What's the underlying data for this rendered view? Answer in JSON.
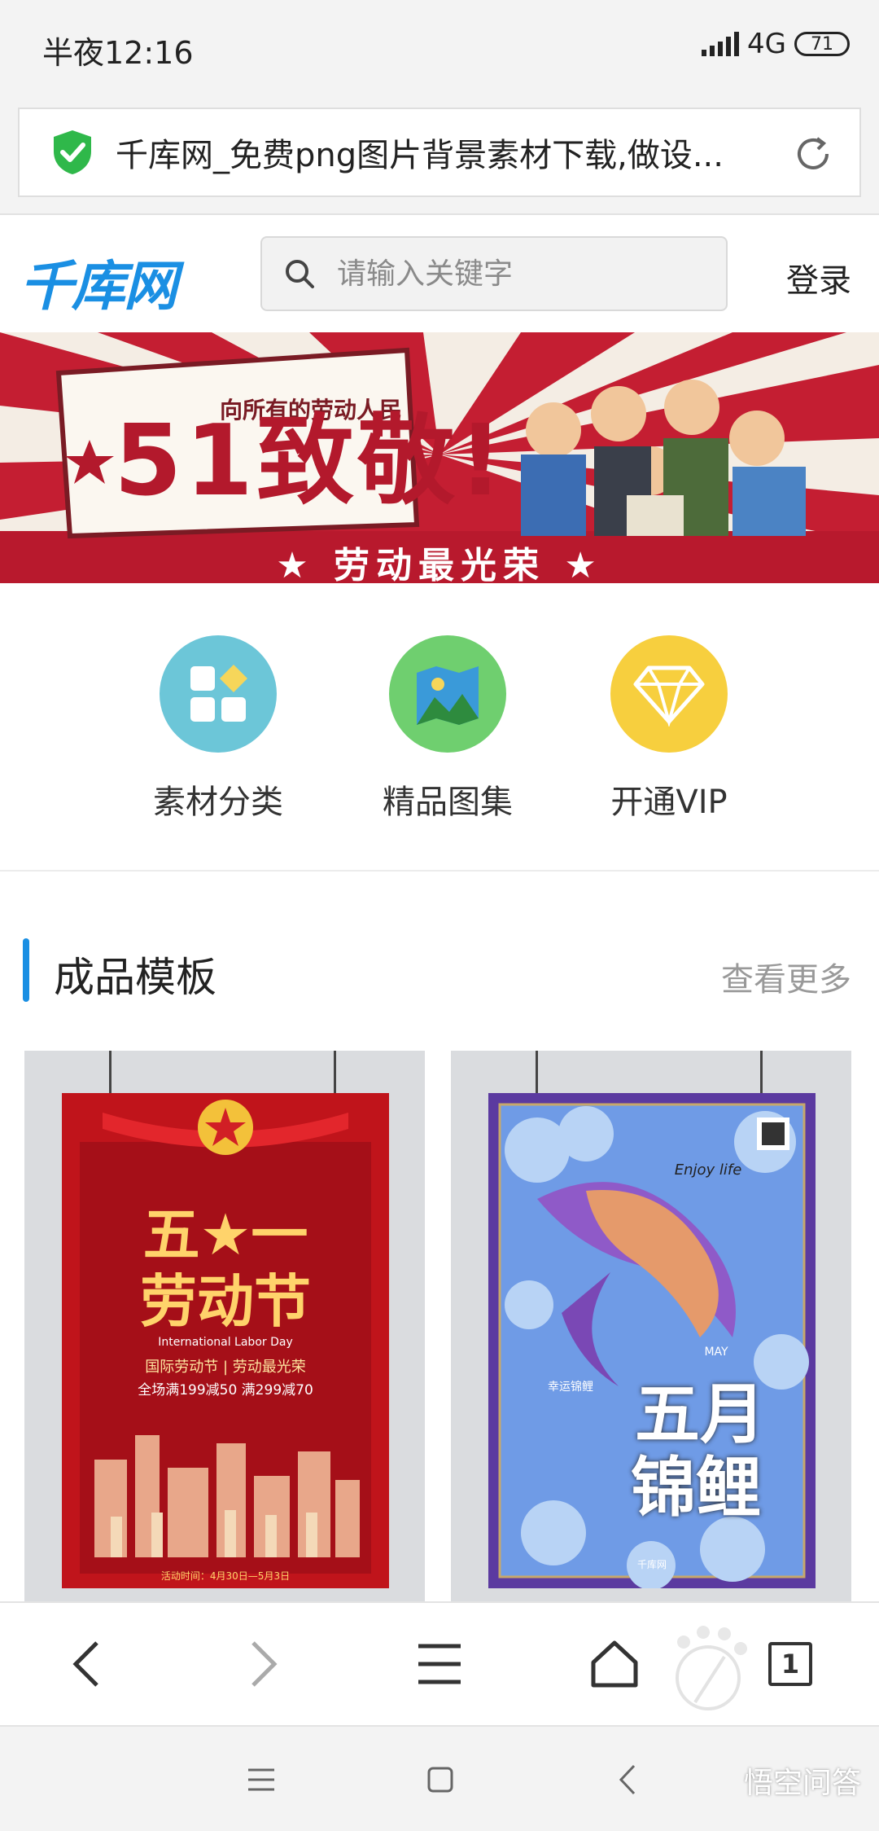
{
  "status_bar": {
    "time": "半夜12:16",
    "network": "4G",
    "battery": "71"
  },
  "url_bar": {
    "title": "千库网_免费png图片背景素材下载,做设..."
  },
  "header": {
    "logo": "千库网",
    "search_placeholder": "请输入关键字",
    "login": "登录"
  },
  "banner": {
    "title": "51致敬!",
    "subtitle": "向所有的劳动人民",
    "slogan": "★ 劳动最光荣 ★"
  },
  "categories": [
    {
      "label": "素材分类",
      "icon": "grid-icon",
      "color": "#6cc6d8"
    },
    {
      "label": "精品图集",
      "icon": "picture-icon",
      "color": "#6fcf6f"
    },
    {
      "label": "开通VIP",
      "icon": "diamond-icon",
      "color": "#f7cf3e"
    }
  ],
  "section": {
    "title": "成品模板",
    "more": "查看更多"
  },
  "templates": [
    {
      "headline_1": "五★一",
      "headline_2": "劳动节",
      "subtitle": "International Labor Day",
      "tag": "国际劳动节 | 劳动最光荣",
      "promo": "全场满199减50 满299减70",
      "date": "活动时间：4月30日—5月3日"
    },
    {
      "headline_1": "五月",
      "headline_2": "锦鲤",
      "subtitle": "Enjoy life",
      "tag": "MAY",
      "promo": "幸运锦鲤",
      "date": "千库网"
    }
  ],
  "browser_nav": {
    "tab_count": "1"
  },
  "watermark": "悟空问答"
}
